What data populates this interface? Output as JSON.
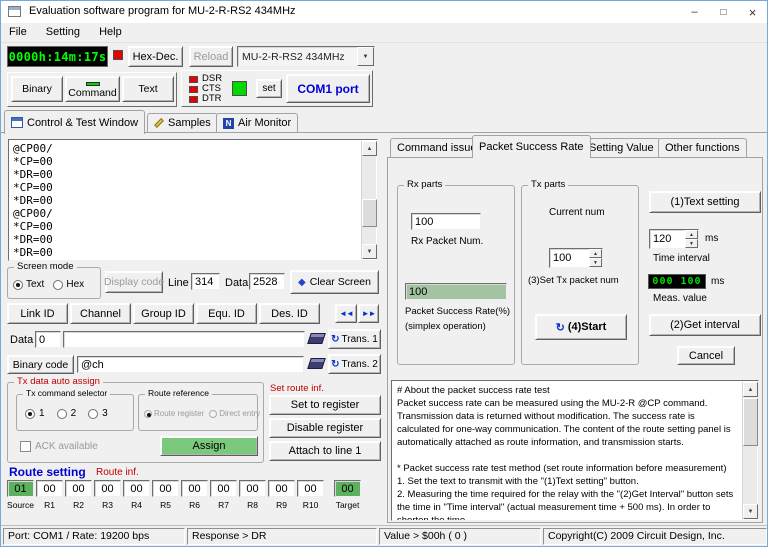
{
  "window": {
    "title": "Evaluation software program for MU-2-R-RS2 434MHz"
  },
  "menu": {
    "items": [
      "File",
      "Setting",
      "Help"
    ]
  },
  "toolbar": {
    "timer": "0000h:14m:17s",
    "hexdec_button": "Hex-Dec.",
    "reload_button": "Reload",
    "device_combo": "MU-2-R-RS2 434MHz",
    "binary_button": "Binary",
    "command_button": "Command",
    "text_button": "Text",
    "dsr_label": "DSR",
    "cts_label": "CTS",
    "dtr_label": "DTR",
    "set_button": "set",
    "com_port_button": "COM1 port"
  },
  "main_tabs": {
    "control": "Control & Test Window",
    "samples": "Samples",
    "air": "Air Monitor"
  },
  "terminal": {
    "lines": [
      "@CP00/",
      "*CP=00",
      "*DR=00",
      "*CP=00",
      "*DR=00",
      "@CP00/",
      "*CP=00",
      "*DR=00",
      "*DR=00"
    ]
  },
  "screen_mode": {
    "title": "Screen mode",
    "text_radio": "Text",
    "hex_radio": "Hex"
  },
  "screen_controls": {
    "display_code_button": "Display code",
    "line_label": "Line",
    "line_value": "314",
    "data_label": "Data",
    "data_value": "2528",
    "clear_screen_button": "Clear Screen"
  },
  "id_buttons": {
    "link": "Link ID",
    "channel": "Channel",
    "group": "Group ID",
    "equ": "Equ. ID",
    "des": "Des. ID"
  },
  "data_entry": {
    "data_label": "Data",
    "data_count": "0",
    "data_text": "",
    "trans1_button": "Trans. 1",
    "binary_code_button": "Binary code",
    "binary_text": "@ch",
    "trans2_button": "Trans. 2"
  },
  "tx_auto": {
    "title": "Tx data auto assign",
    "selector_title": "Tx command selector",
    "radio1": "1",
    "radio2": "2",
    "radio3": "3",
    "route_ref_title": "Route reference",
    "route_register_radio": "Route register",
    "direct_entry_radio": "Direct entry",
    "ack_checkbox": "ACK available",
    "assign_button": "Assign"
  },
  "set_route": {
    "title": "Set route inf.",
    "set_register_button": "Set to register",
    "disable_register_button": "Disable register",
    "attach_button": "Attach to line 1"
  },
  "route": {
    "title": "Route setting",
    "inf_label": "Route inf.",
    "cells": [
      {
        "value": "01",
        "label": "Source"
      },
      {
        "value": "00",
        "label": "R1"
      },
      {
        "value": "00",
        "label": "R2"
      },
      {
        "value": "00",
        "label": "R3"
      },
      {
        "value": "00",
        "label": "R4"
      },
      {
        "value": "00",
        "label": "R5"
      },
      {
        "value": "00",
        "label": "R6"
      },
      {
        "value": "00",
        "label": "R7"
      },
      {
        "value": "00",
        "label": "R8"
      },
      {
        "value": "00",
        "label": "R9"
      },
      {
        "value": "00",
        "label": "R10"
      },
      {
        "value": "00",
        "label": "Target"
      }
    ]
  },
  "right_tabs": {
    "command_issue": "Command issue",
    "packet_success": "Packet Success Rate",
    "setting_value": "Setting Value",
    "other_functions": "Other functions"
  },
  "psr": {
    "rx_title": "Rx parts",
    "rx_packet_num": "100",
    "rx_packet_label": "Rx Packet Num.",
    "success_rate": "100",
    "success_rate_label": "Packet Success Rate(%)",
    "success_rate_label2": "(simplex operation)",
    "tx_title": "Tx parts",
    "current_num_label": "Current num",
    "tx_packet_num": "100",
    "set_tx_label": "(3)Set Tx packet num",
    "start_button": "(4)Start",
    "text_setting_button": "(1)Text setting",
    "time_interval": "120",
    "ms_label": "ms",
    "time_interval_label": "Time interval",
    "meas_value": "000 100",
    "meas_ms": "ms",
    "meas_label": "Meas. value",
    "get_interval_button": "(2)Get interval",
    "cancel_button": "Cancel"
  },
  "info": {
    "text": "# About the packet success rate test\nPacket success rate can be measured using the MU-2-R @CP command. Transmission data is returned without modification. The success rate is calculated for one-way communication. The content of the route setting panel is automatically attached as route information, and transmission starts.\n\n* Packet success rate test method (set route information before measurement)\n1. Set the text to transmit with the \"(1)Text setting\" button.\n2. Measuring the time required for the relay with the \"(2)Get Interval\" button sets the time in \"Time interval\" (actual measurement time + 500 ms). In order to shorten the time"
  },
  "statusbar": {
    "port": "Port: COM1 / Rate: 19200 bps",
    "response": "Response > DR",
    "value": "Value > $00h ( 0 )",
    "copyright": "Copyright(C) 2009 Circuit Design, Inc."
  }
}
